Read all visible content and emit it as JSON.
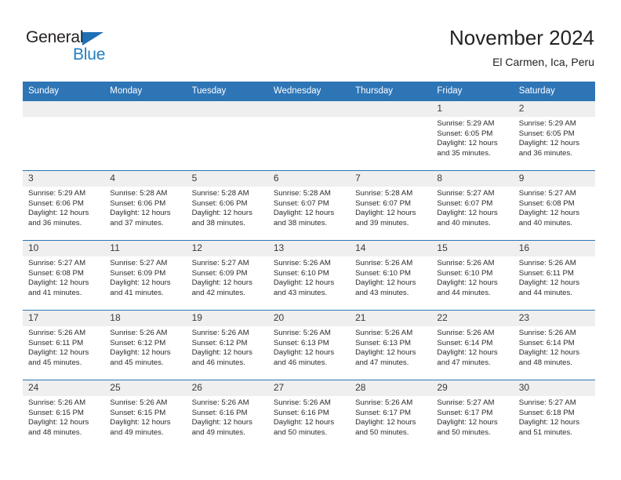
{
  "brand": {
    "name_part1": "General",
    "name_part2": "Blue",
    "accent_color": "#1f7fc4",
    "triangle_color": "#1f6fb5"
  },
  "header": {
    "month_title": "November 2024",
    "location": "El Carmen, Ica, Peru"
  },
  "theme": {
    "header_row_bg": "#2e75b6",
    "daynum_bg": "#efefef",
    "grid_line": "#2e75b6",
    "text": "#222222"
  },
  "calendar": {
    "weekday_headers": [
      "Sunday",
      "Monday",
      "Tuesday",
      "Wednesday",
      "Thursday",
      "Friday",
      "Saturday"
    ],
    "weeks": [
      [
        {
          "day": "",
          "empty": true
        },
        {
          "day": "",
          "empty": true
        },
        {
          "day": "",
          "empty": true
        },
        {
          "day": "",
          "empty": true
        },
        {
          "day": "",
          "empty": true
        },
        {
          "day": "1",
          "sunrise": "Sunrise: 5:29 AM",
          "sunset": "Sunset: 6:05 PM",
          "daylight1": "Daylight: 12 hours",
          "daylight2": "and 35 minutes."
        },
        {
          "day": "2",
          "sunrise": "Sunrise: 5:29 AM",
          "sunset": "Sunset: 6:05 PM",
          "daylight1": "Daylight: 12 hours",
          "daylight2": "and 36 minutes."
        }
      ],
      [
        {
          "day": "3",
          "sunrise": "Sunrise: 5:29 AM",
          "sunset": "Sunset: 6:06 PM",
          "daylight1": "Daylight: 12 hours",
          "daylight2": "and 36 minutes."
        },
        {
          "day": "4",
          "sunrise": "Sunrise: 5:28 AM",
          "sunset": "Sunset: 6:06 PM",
          "daylight1": "Daylight: 12 hours",
          "daylight2": "and 37 minutes."
        },
        {
          "day": "5",
          "sunrise": "Sunrise: 5:28 AM",
          "sunset": "Sunset: 6:06 PM",
          "daylight1": "Daylight: 12 hours",
          "daylight2": "and 38 minutes."
        },
        {
          "day": "6",
          "sunrise": "Sunrise: 5:28 AM",
          "sunset": "Sunset: 6:07 PM",
          "daylight1": "Daylight: 12 hours",
          "daylight2": "and 38 minutes."
        },
        {
          "day": "7",
          "sunrise": "Sunrise: 5:28 AM",
          "sunset": "Sunset: 6:07 PM",
          "daylight1": "Daylight: 12 hours",
          "daylight2": "and 39 minutes."
        },
        {
          "day": "8",
          "sunrise": "Sunrise: 5:27 AM",
          "sunset": "Sunset: 6:07 PM",
          "daylight1": "Daylight: 12 hours",
          "daylight2": "and 40 minutes."
        },
        {
          "day": "9",
          "sunrise": "Sunrise: 5:27 AM",
          "sunset": "Sunset: 6:08 PM",
          "daylight1": "Daylight: 12 hours",
          "daylight2": "and 40 minutes."
        }
      ],
      [
        {
          "day": "10",
          "sunrise": "Sunrise: 5:27 AM",
          "sunset": "Sunset: 6:08 PM",
          "daylight1": "Daylight: 12 hours",
          "daylight2": "and 41 minutes."
        },
        {
          "day": "11",
          "sunrise": "Sunrise: 5:27 AM",
          "sunset": "Sunset: 6:09 PM",
          "daylight1": "Daylight: 12 hours",
          "daylight2": "and 41 minutes."
        },
        {
          "day": "12",
          "sunrise": "Sunrise: 5:27 AM",
          "sunset": "Sunset: 6:09 PM",
          "daylight1": "Daylight: 12 hours",
          "daylight2": "and 42 minutes."
        },
        {
          "day": "13",
          "sunrise": "Sunrise: 5:26 AM",
          "sunset": "Sunset: 6:10 PM",
          "daylight1": "Daylight: 12 hours",
          "daylight2": "and 43 minutes."
        },
        {
          "day": "14",
          "sunrise": "Sunrise: 5:26 AM",
          "sunset": "Sunset: 6:10 PM",
          "daylight1": "Daylight: 12 hours",
          "daylight2": "and 43 minutes."
        },
        {
          "day": "15",
          "sunrise": "Sunrise: 5:26 AM",
          "sunset": "Sunset: 6:10 PM",
          "daylight1": "Daylight: 12 hours",
          "daylight2": "and 44 minutes."
        },
        {
          "day": "16",
          "sunrise": "Sunrise: 5:26 AM",
          "sunset": "Sunset: 6:11 PM",
          "daylight1": "Daylight: 12 hours",
          "daylight2": "and 44 minutes."
        }
      ],
      [
        {
          "day": "17",
          "sunrise": "Sunrise: 5:26 AM",
          "sunset": "Sunset: 6:11 PM",
          "daylight1": "Daylight: 12 hours",
          "daylight2": "and 45 minutes."
        },
        {
          "day": "18",
          "sunrise": "Sunrise: 5:26 AM",
          "sunset": "Sunset: 6:12 PM",
          "daylight1": "Daylight: 12 hours",
          "daylight2": "and 45 minutes."
        },
        {
          "day": "19",
          "sunrise": "Sunrise: 5:26 AM",
          "sunset": "Sunset: 6:12 PM",
          "daylight1": "Daylight: 12 hours",
          "daylight2": "and 46 minutes."
        },
        {
          "day": "20",
          "sunrise": "Sunrise: 5:26 AM",
          "sunset": "Sunset: 6:13 PM",
          "daylight1": "Daylight: 12 hours",
          "daylight2": "and 46 minutes."
        },
        {
          "day": "21",
          "sunrise": "Sunrise: 5:26 AM",
          "sunset": "Sunset: 6:13 PM",
          "daylight1": "Daylight: 12 hours",
          "daylight2": "and 47 minutes."
        },
        {
          "day": "22",
          "sunrise": "Sunrise: 5:26 AM",
          "sunset": "Sunset: 6:14 PM",
          "daylight1": "Daylight: 12 hours",
          "daylight2": "and 47 minutes."
        },
        {
          "day": "23",
          "sunrise": "Sunrise: 5:26 AM",
          "sunset": "Sunset: 6:14 PM",
          "daylight1": "Daylight: 12 hours",
          "daylight2": "and 48 minutes."
        }
      ],
      [
        {
          "day": "24",
          "sunrise": "Sunrise: 5:26 AM",
          "sunset": "Sunset: 6:15 PM",
          "daylight1": "Daylight: 12 hours",
          "daylight2": "and 48 minutes."
        },
        {
          "day": "25",
          "sunrise": "Sunrise: 5:26 AM",
          "sunset": "Sunset: 6:15 PM",
          "daylight1": "Daylight: 12 hours",
          "daylight2": "and 49 minutes."
        },
        {
          "day": "26",
          "sunrise": "Sunrise: 5:26 AM",
          "sunset": "Sunset: 6:16 PM",
          "daylight1": "Daylight: 12 hours",
          "daylight2": "and 49 minutes."
        },
        {
          "day": "27",
          "sunrise": "Sunrise: 5:26 AM",
          "sunset": "Sunset: 6:16 PM",
          "daylight1": "Daylight: 12 hours",
          "daylight2": "and 50 minutes."
        },
        {
          "day": "28",
          "sunrise": "Sunrise: 5:26 AM",
          "sunset": "Sunset: 6:17 PM",
          "daylight1": "Daylight: 12 hours",
          "daylight2": "and 50 minutes."
        },
        {
          "day": "29",
          "sunrise": "Sunrise: 5:27 AM",
          "sunset": "Sunset: 6:17 PM",
          "daylight1": "Daylight: 12 hours",
          "daylight2": "and 50 minutes."
        },
        {
          "day": "30",
          "sunrise": "Sunrise: 5:27 AM",
          "sunset": "Sunset: 6:18 PM",
          "daylight1": "Daylight: 12 hours",
          "daylight2": "and 51 minutes."
        }
      ]
    ]
  }
}
